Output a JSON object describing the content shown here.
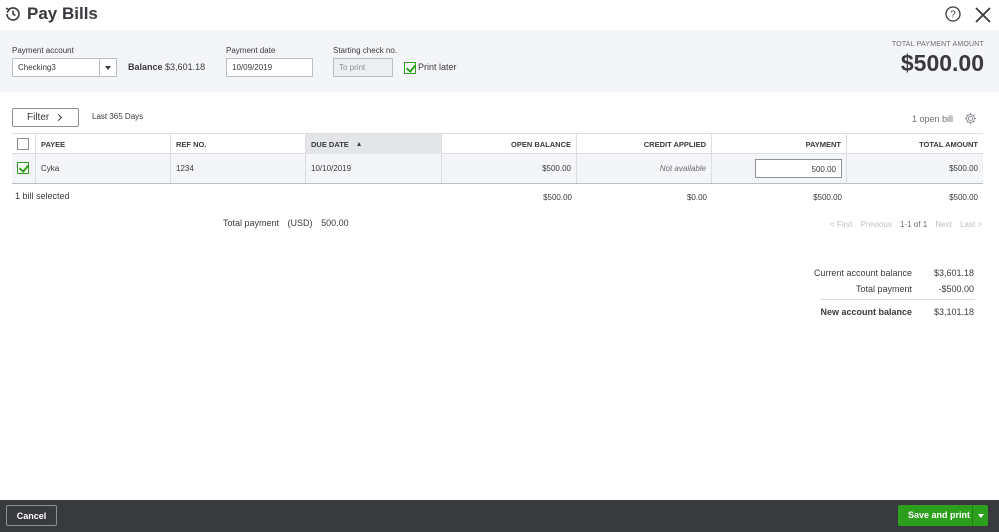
{
  "header": {
    "title": "Pay Bills"
  },
  "form": {
    "payment_account_label": "Payment account",
    "payment_account_value": "Checking3",
    "balance_label": "Balance",
    "balance_value": "$3,601.18",
    "payment_date_label": "Payment date",
    "payment_date_value": "10/09/2019",
    "starting_check_label": "Starting check no.",
    "starting_check_placeholder": "To print",
    "print_later_label": "Print later",
    "print_later_checked": true,
    "total_payment_amount_label": "TOTAL PAYMENT AMOUNT",
    "total_payment_amount_value": "$500.00"
  },
  "filter": {
    "button_label": "Filter",
    "range_text": "Last 365 Days",
    "open_bill_text": "1 open bill"
  },
  "table": {
    "columns": [
      "PAYEE",
      "REF NO.",
      "DUE DATE",
      "OPEN BALANCE",
      "CREDIT APPLIED",
      "PAYMENT",
      "TOTAL AMOUNT"
    ],
    "rows": [
      {
        "checked": true,
        "payee": "Cyka",
        "ref_no": "1234",
        "due_date": "10/10/2019",
        "open_balance": "$500.00",
        "credit_applied": "Not available",
        "payment": "500.00",
        "total_amount": "$500.00"
      }
    ],
    "totals": {
      "selected_text": "1 bill selected",
      "open_balance": "$500.00",
      "credit_applied": "$0.00",
      "payment": "$500.00",
      "total_amount": "$500.00"
    }
  },
  "total_payment": {
    "label": "Total payment",
    "currency": "(USD)",
    "value": "500.00"
  },
  "pager": {
    "first": "< First",
    "previous": "Previous",
    "range": "1-1 of 1",
    "next": "Next",
    "last": "Last >"
  },
  "summary": {
    "current_balance_label": "Current account balance",
    "current_balance_value": "$3,601.18",
    "total_payment_label": "Total payment",
    "total_payment_value": "-$500.00",
    "new_balance_label": "New account balance",
    "new_balance_value": "$3,101.18"
  },
  "footer": {
    "cancel_label": "Cancel",
    "save_label": "Save and print"
  },
  "colors": {
    "accent_green": "#2ca01c",
    "footer_bg": "#393a3d",
    "form_bg": "#f4f5f8"
  }
}
